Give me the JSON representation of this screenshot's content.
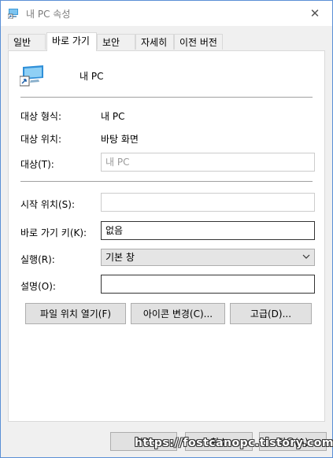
{
  "window": {
    "title": "내 PC 속성"
  },
  "tabs": [
    {
      "label": "일반"
    },
    {
      "label": "바로 가기"
    },
    {
      "label": "보안"
    },
    {
      "label": "자세히"
    },
    {
      "label": "이전 버전"
    }
  ],
  "header": {
    "name": "내 PC"
  },
  "info": {
    "target_type_label": "대상 형식:",
    "target_type_value": "내 PC",
    "target_location_label": "대상 위치:",
    "target_location_value": "바탕 화면"
  },
  "fields": {
    "target_label": "대상(T):",
    "target_value": "내 PC",
    "start_in_label": "시작 위치(S):",
    "start_in_value": "",
    "shortcut_key_label": "바로 가기 키(K):",
    "shortcut_key_value": "없음",
    "run_label": "실행(R):",
    "run_value": "기본 창",
    "comment_label": "설명(O):",
    "comment_value": ""
  },
  "buttons": {
    "open_location": "파일 위치 열기(F)",
    "change_icon": "아이콘 변경(C)...",
    "advanced": "고급(D)..."
  },
  "footer": {
    "ok": "확인",
    "cancel": "취소",
    "apply": "적용(A)"
  },
  "watermark": "https://fostcanopc.tistory.com"
}
